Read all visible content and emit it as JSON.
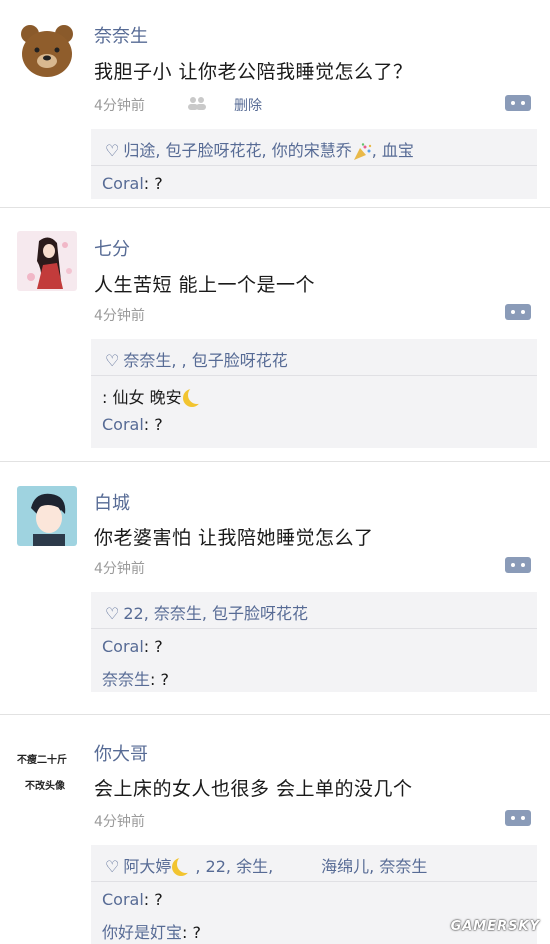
{
  "posts": [
    {
      "name": "奈奈生",
      "content": "我胆子小 让你老公陪我睡觉怎么了？",
      "time": "4分钟前",
      "delete": "删除",
      "likes": "归途, 包子脸呀花花, 你的宋慧乔",
      "likes_tail": ", 血宝",
      "comments": [
        {
          "who": "Coral",
          "text": ": ?"
        }
      ]
    },
    {
      "name": "七分",
      "content": "人生苦短 能上一个是一个",
      "time": "4分钟前",
      "likes": "奈奈生, , 包子脸呀花花",
      "comments": [
        {
          "who": "",
          "text": ": 仙女 晚安"
        },
        {
          "who": "Coral",
          "text": ": ?"
        }
      ]
    },
    {
      "name": "白城",
      "content": "你老婆害怕 让我陪她睡觉怎么了",
      "time": "4分钟前",
      "likes": "22, 奈奈生, 包子脸呀花花",
      "comments": [
        {
          "who": "Coral",
          "text": ": ?"
        },
        {
          "who": "奈奈生",
          "text": ": ?"
        }
      ]
    },
    {
      "name": "你大哥",
      "content": "会上床的女人也很多 会上单的没几个",
      "time": "4分钟前",
      "avatar_text": [
        "不瘦二十斤",
        "不改头像"
      ],
      "likes": "阿大婷",
      "likes_tail": ", 22, 余生,",
      "likes_tail2": "海绵儿, 奈奈生",
      "comments": [
        {
          "who": "Coral",
          "text": ": ?"
        },
        {
          "who": "你好是奵宝",
          "text": ": ?"
        }
      ]
    }
  ],
  "heart_icon": "♡",
  "watermark": "GAMERSKY",
  "colors": {
    "link": "#576b95",
    "text": "#1a1a1a",
    "time": "#9b9b9b",
    "box": "#f3f3f5"
  }
}
